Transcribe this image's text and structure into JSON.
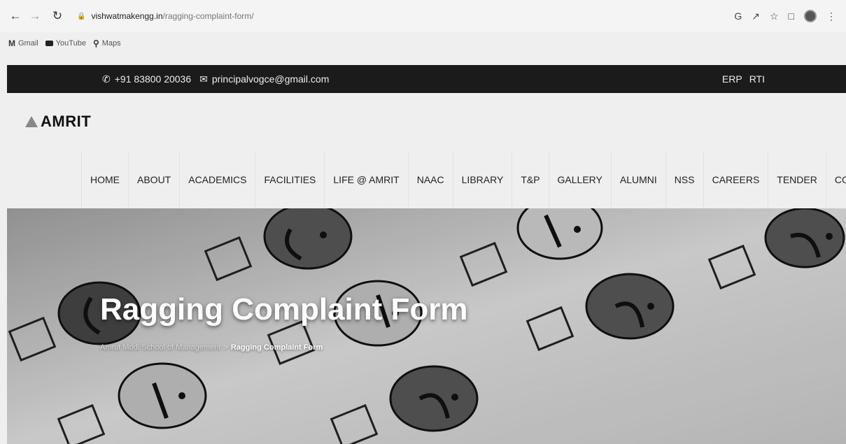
{
  "browser": {
    "url_host": "vishwatmakengg.in",
    "url_path": "/ragging-complaint-form/",
    "bookmarks": [
      {
        "label": "Gmail"
      },
      {
        "label": "YouTube"
      },
      {
        "label": "Maps"
      }
    ]
  },
  "topbar": {
    "phone": "+91 83800 20036",
    "email": "principalvogce@gmail.com",
    "links": [
      "ERP",
      "RTI"
    ]
  },
  "logo": {
    "text": "AMRIT"
  },
  "nav": {
    "items": [
      "HOME",
      "ABOUT",
      "ACADEMICS",
      "FACILITIES",
      "LIFE @ AMRIT",
      "NAAC",
      "LIBRARY",
      "T&P",
      "GALLERY",
      "ALUMNI",
      "NSS",
      "CAREERS",
      "TENDER",
      "CONTACT"
    ]
  },
  "hero": {
    "title": "Ragging Complaint Form",
    "breadcrumb_home": "Amrut Modi School of Management",
    "breadcrumb_sep": ">",
    "breadcrumb_current": "Ragging Complaint Form"
  }
}
